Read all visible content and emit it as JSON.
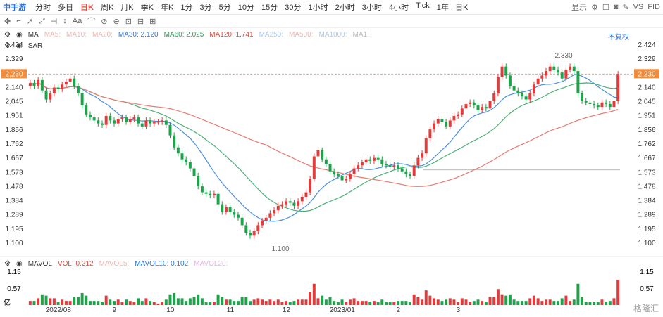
{
  "toolbar": {
    "stock_name": "中手游",
    "periods": [
      "分时",
      "多日",
      "日K",
      "周K",
      "月K",
      "季K",
      "年K",
      "1分",
      "3分",
      "5分",
      "10分",
      "15分",
      "30分",
      "1小时",
      "2小时",
      "3小时",
      "4小时",
      "Tick",
      "1年 : 日K"
    ],
    "active_period": "日K",
    "display_label": "显示",
    "vs_label": "VS",
    "fid_label": "FID"
  },
  "drawbar": {
    "items": [
      "✥",
      "⌐",
      "↗",
      "⤢",
      "⊣",
      "↕",
      "Aa",
      "⌒",
      "⊘",
      "⊖",
      "⊡",
      "⊟",
      "⊞"
    ]
  },
  "indicators": {
    "ma_label": "MA",
    "ma5": "MA5:",
    "ma10": "MA10:",
    "ma20": "MA20:",
    "ma30": "MA30: 2.120",
    "ma60": "MA60: 2.025",
    "ma120": "MA120: 1.741",
    "ma250": "MA250:",
    "ma500": "MA500:",
    "ma1000": "MA1000:",
    "ma1": "MA1:",
    "sar_label": "SAR"
  },
  "fuquan": "不复权",
  "price_axis": [
    "2.424",
    "2.329",
    "2.230",
    "2.140",
    "2.045",
    "1.951",
    "1.856",
    "1.762",
    "1.667",
    "1.573",
    "1.478",
    "1.384",
    "1.289",
    "1.195",
    "1.100"
  ],
  "current_price": "2.230",
  "annotations": {
    "high": "2.330",
    "low": "1.100"
  },
  "vol_panel": {
    "label": "MAVOL",
    "vol": "VOL: 0.212",
    "mavol5": "MAVOL5:",
    "mavol10": "MAVOL10: 0.102",
    "mavol20": "MAVOL20:",
    "axis": [
      "1.15",
      "0.57",
      "亿"
    ]
  },
  "x_axis": [
    "2022/08",
    "9",
    "10",
    "11",
    "12",
    "2023/01",
    "2",
    "3"
  ],
  "colors": {
    "up": "#e23b3b",
    "down": "#1fa34a",
    "ma30": "#4a90e2",
    "ma60": "#4caf78",
    "ma120": "#e77b72",
    "price_line": "#f5a06b"
  },
  "watermark": "格隆汇",
  "chart_data": {
    "type": "candlestick",
    "ylim": [
      1.1,
      2.424
    ],
    "closes": [
      2.17,
      2.15,
      2.19,
      2.12,
      2.06,
      2.1,
      2.14,
      2.13,
      2.16,
      2.18,
      2.2,
      2.15,
      2.1,
      2.02,
      1.96,
      1.94,
      1.92,
      1.9,
      1.89,
      1.95,
      1.92,
      1.9,
      1.93,
      1.94,
      1.91,
      1.93,
      1.94,
      1.9,
      1.88,
      1.92,
      1.9,
      1.91,
      1.91,
      1.92,
      1.89,
      1.82,
      1.74,
      1.7,
      1.66,
      1.64,
      1.6,
      1.55,
      1.48,
      1.44,
      1.43,
      1.42,
      1.43,
      1.36,
      1.31,
      1.34,
      1.31,
      1.29,
      1.27,
      1.22,
      1.17,
      1.15,
      1.18,
      1.22,
      1.25,
      1.27,
      1.3,
      1.32,
      1.35,
      1.36,
      1.38,
      1.37,
      1.35,
      1.38,
      1.41,
      1.44,
      1.53,
      1.68,
      1.72,
      1.66,
      1.63,
      1.58,
      1.56,
      1.55,
      1.52,
      1.53,
      1.56,
      1.6,
      1.62,
      1.64,
      1.66,
      1.65,
      1.67,
      1.66,
      1.63,
      1.62,
      1.61,
      1.62,
      1.6,
      1.58,
      1.56,
      1.55,
      1.62,
      1.67,
      1.7,
      1.8,
      1.86,
      1.9,
      1.93,
      1.91,
      1.88,
      1.92,
      1.95,
      1.96,
      2.0,
      2.03,
      2.04,
      2.02,
      1.99,
      2.01,
      2.0,
      2.05,
      2.1,
      2.21,
      2.28,
      2.22,
      2.15,
      2.12,
      2.1,
      2.08,
      2.06,
      2.1,
      2.16,
      2.2,
      2.22,
      2.25,
      2.28,
      2.26,
      2.24,
      2.2,
      2.26,
      2.28,
      2.25,
      2.1,
      2.05,
      2.04,
      2.03,
      2.02,
      2.01,
      2.04,
      2.03,
      2.01,
      2.05,
      2.23
    ]
  }
}
